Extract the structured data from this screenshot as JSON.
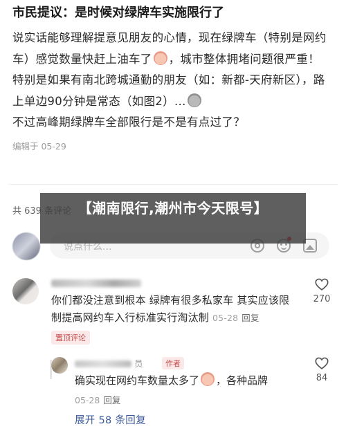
{
  "post": {
    "title": "市民提议：是时候对绿牌车实施限行了",
    "paragraph1_a": "说实话能够理解提意见朋友的心情，现在绿牌车（特别是网约车）感觉数量快赶上油车了",
    "paragraph1_b": "，城市整体拥堵问题很严重！",
    "paragraph2_a": "特别是如果有南北跨城通勤的朋友（如：新都-天府新区），路上单边90分钟是常态（如图2）...",
    "paragraph3": "不过高峰期绿牌车全部限行是不是有点过了？",
    "edited": "编辑于 05-29"
  },
  "comments_header": {
    "count_text": "共 639 条评论"
  },
  "overlay": {
    "text": "【潮南限行,潮州市今天限号】"
  },
  "comment_input": {
    "placeholder": "说点什么..."
  },
  "comment1": {
    "text": "你们都没注意到根本  绿牌有很多私家车  其实应该限制提高网约车入行标准实行淘汰制",
    "date": "05-28",
    "reply_label": "回复",
    "pinned_label": "置顶评论",
    "likes": "270"
  },
  "reply1": {
    "username_tail": "员",
    "author_label": "作者",
    "text_a": "确实现在网约车数量太多了",
    "text_b": "，各种品牌",
    "date": "05-28",
    "reply_label": "回复",
    "likes": "84"
  },
  "expand": {
    "label": "展开 58 条回复"
  },
  "icons": {
    "input_icons": [
      "at-icon",
      "emoji-icon",
      "image-icon"
    ],
    "like_icon": "heart-icon"
  },
  "colors": {
    "tag_red": "#c44a4a",
    "tag_bg": "#fbe9e9",
    "link_blue": "#3b5998",
    "notify_dot": "#ff2442"
  }
}
